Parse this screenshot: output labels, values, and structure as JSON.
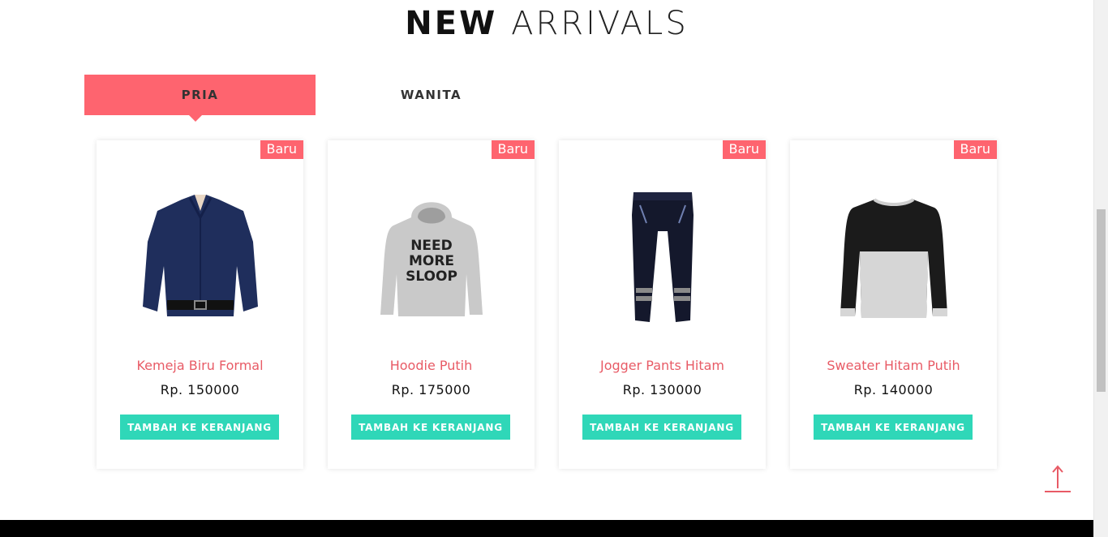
{
  "section": {
    "title_bold": "NEW",
    "title_light": "ARRIVALS"
  },
  "tabs": [
    {
      "label": "PRIA",
      "active": true
    },
    {
      "label": "WANITA",
      "active": false
    }
  ],
  "products": [
    {
      "badge": "Baru",
      "name": "Kemeja Biru Formal",
      "price": "Rp. 150000",
      "button": "TAMBAH KE KERANJANG",
      "image": "navy-shirt-image"
    },
    {
      "badge": "Baru",
      "name": "Hoodie Putih",
      "price": "Rp. 175000",
      "button": "TAMBAH KE KERANJANG",
      "image": "grey-hoodie-image",
      "image_text": [
        "NEED",
        "MORE",
        "SLOOP"
      ]
    },
    {
      "badge": "Baru",
      "name": "Jogger Pants Hitam",
      "price": "Rp. 130000",
      "button": "TAMBAH KE KERANJANG",
      "image": "black-jogger-image"
    },
    {
      "badge": "Baru",
      "name": "Sweater Hitam Putih",
      "price": "Rp. 140000",
      "button": "TAMBAH KE KERANJANG",
      "image": "black-white-sweater-image"
    }
  ],
  "colors": {
    "accent": "#fe646f",
    "product_name": "#e85b66",
    "button": "#2fd7b8",
    "footer": "#000000"
  },
  "icons": {
    "back_to_top": "arrow-up-icon"
  }
}
